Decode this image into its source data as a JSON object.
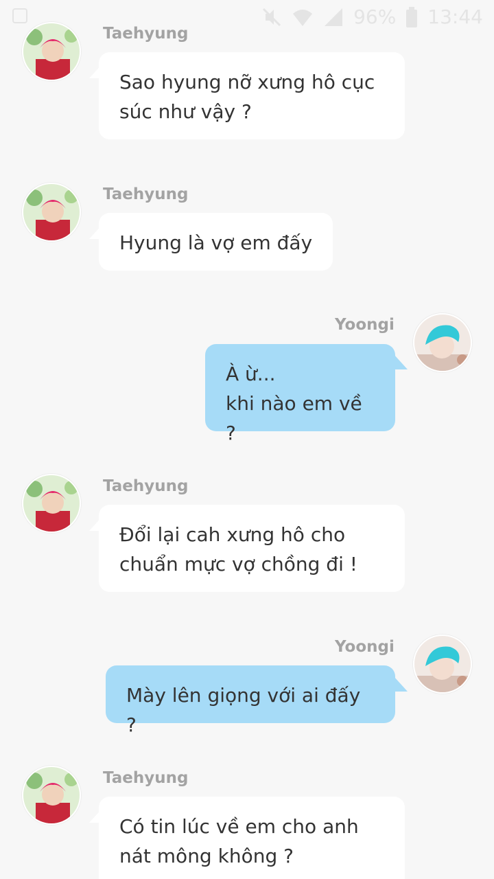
{
  "status_bar": {
    "battery": "96%",
    "time": "13:44",
    "icons": [
      "image-notification-icon",
      "mute-icon",
      "wifi-icon",
      "signal-icon",
      "battery-icon"
    ]
  },
  "colors": {
    "background": "#f7f7f7",
    "incoming_bubble": "#ffffff",
    "outgoing_bubble": "#a6dbf7",
    "sender_name": "#a3a3a3",
    "text": "#333333"
  },
  "messages": [
    {
      "sender": "Taehyung",
      "direction": "incoming",
      "text": "Sao hyung nỡ xưng hô cục\nsúc như vậy ?"
    },
    {
      "sender": "Taehyung",
      "direction": "incoming",
      "text": "Hyung là vợ em đấy"
    },
    {
      "sender": "Yoongi",
      "direction": "outgoing",
      "text": "À ừ...\nkhi nào em về ?"
    },
    {
      "sender": "Taehyung",
      "direction": "incoming",
      "text": "Đổi lại cah xưng hô cho\nchuẩn mực vợ chồng đi !"
    },
    {
      "sender": "Yoongi",
      "direction": "outgoing",
      "text": "Mày lên giọng với ai đấy ?"
    },
    {
      "sender": "Taehyung",
      "direction": "incoming",
      "text": "Có tin lúc về em cho anh\nnát mông không ?"
    }
  ]
}
